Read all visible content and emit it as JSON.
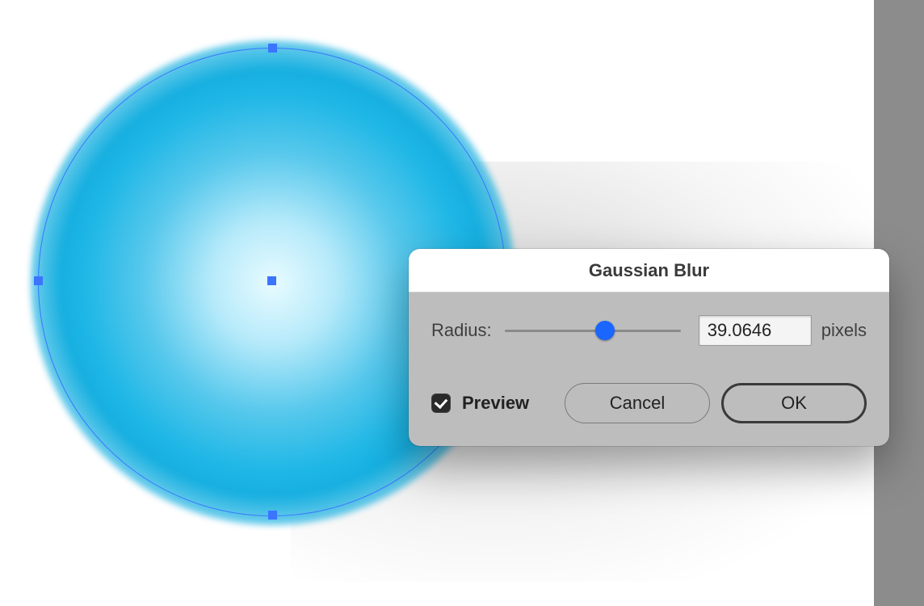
{
  "dialog": {
    "title": "Gaussian Blur",
    "radius_label": "Radius:",
    "radius_value": "39.0646",
    "radius_unit": "pixels",
    "slider_percent": 57,
    "preview_label": "Preview",
    "preview_checked": true,
    "cancel_label": "Cancel",
    "ok_label": "OK"
  },
  "artwork": {
    "shape": "ellipse",
    "selected": true
  }
}
